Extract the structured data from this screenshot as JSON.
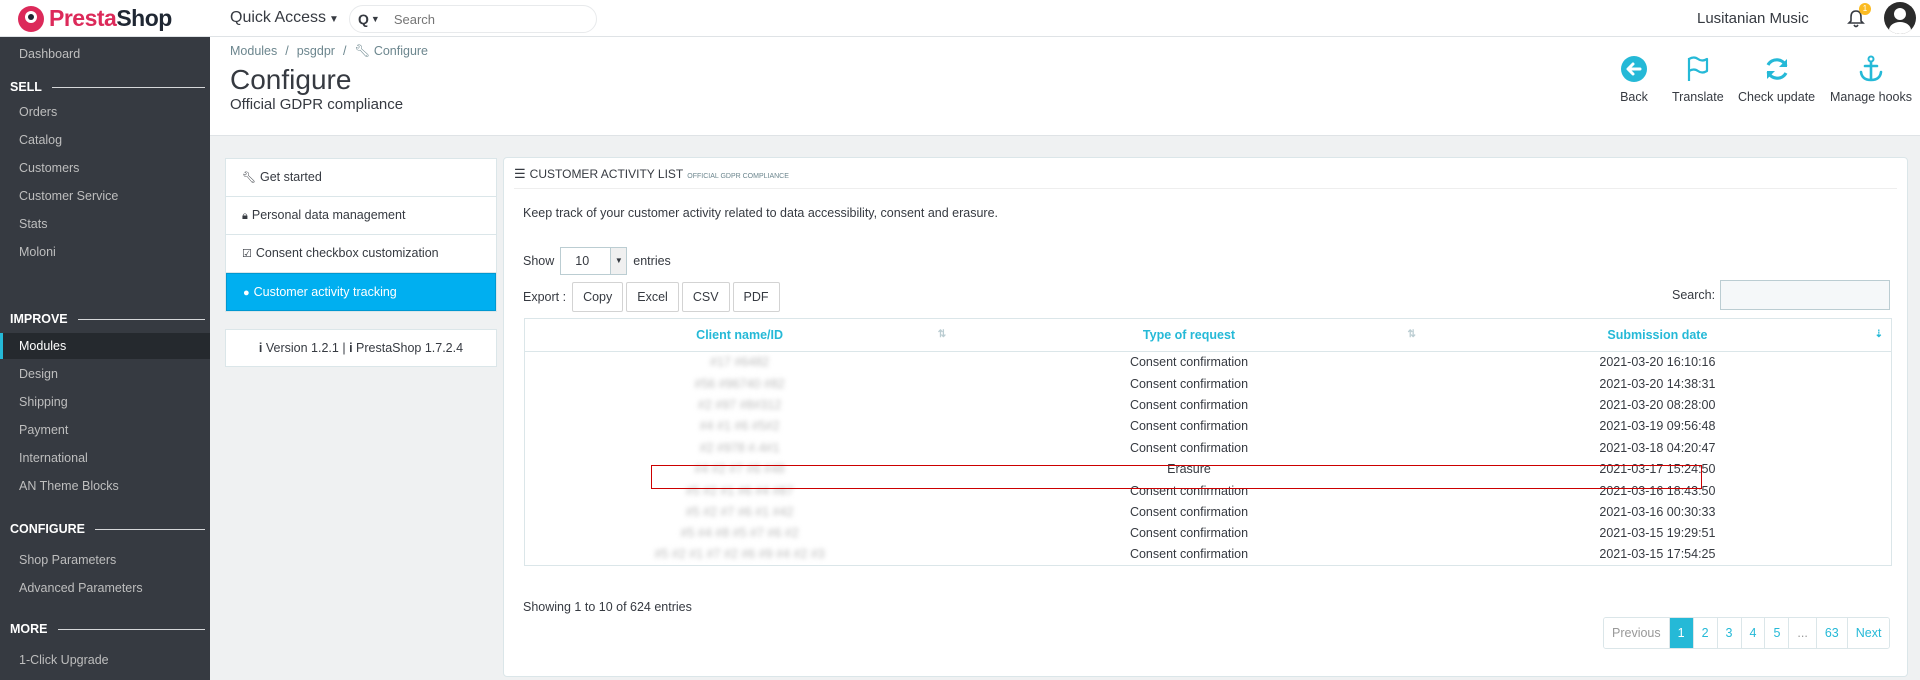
{
  "header": {
    "logo_prefix": "Presta",
    "logo_suffix": "Shop",
    "quick_access": "Quick Access",
    "search_placeholder": "Search",
    "shop_name": "Lusitanian Music",
    "notification_count": "1"
  },
  "sidebar": {
    "dashboard": "Dashboard",
    "sections": [
      {
        "title": "SELL",
        "items": [
          "Orders",
          "Catalog",
          "Customers",
          "Customer Service",
          "Stats",
          "Moloni"
        ]
      },
      {
        "title": "IMPROVE",
        "items": [
          "Modules",
          "Design",
          "Shipping",
          "Payment",
          "International",
          "AN Theme Blocks"
        ]
      },
      {
        "title": "CONFIGURE",
        "items": [
          "Shop Parameters",
          "Advanced Parameters"
        ]
      },
      {
        "title": "MORE",
        "items": [
          "1-Click Upgrade"
        ]
      }
    ],
    "active_item": "Modules"
  },
  "breadcrumb": [
    "Modules",
    "psgdpr",
    "Configure"
  ],
  "page": {
    "title": "Configure",
    "subtitle": "Official GDPR compliance"
  },
  "toolbar": {
    "back": "Back",
    "translate": "Translate",
    "check_update": "Check update",
    "manage_hooks": "Manage hooks"
  },
  "module_menu": {
    "items": [
      "Get started",
      "Personal data management",
      "Consent checkbox customization",
      "Customer activity tracking"
    ],
    "active": "Customer activity tracking",
    "version": "Version 1.2.1 | ",
    "prestashop_version": "PrestaShop 1.7.2.4"
  },
  "panel": {
    "title": "CUSTOMER ACTIVITY LIST",
    "title_small": "OFFICIAL GDPR COMPLIANCE",
    "description": "Keep track of your customer activity related to data accessibility, consent and erasure.",
    "show_label": "Show",
    "show_value": "10",
    "entries_label": "entries",
    "export_label": "Export :",
    "export_buttons": [
      "Copy",
      "Excel",
      "CSV",
      "PDF"
    ],
    "search_label": "Search:",
    "showing_text": "Showing 1 to 10 of 624 entries"
  },
  "table": {
    "columns": [
      "Client name/ID",
      "Type of request",
      "Submission date"
    ],
    "rows": [
      {
        "client": "#17 #6482",
        "type": "Consent confirmation",
        "date": "2021-03-20 16:10:16"
      },
      {
        "client": "#56 #96740 #82",
        "type": "Consent confirmation",
        "date": "2021-03-20 14:38:31"
      },
      {
        "client": "#2 #97 #8#312",
        "type": "Consent confirmation",
        "date": "2021-03-20 08:28:00"
      },
      {
        "client": "#4 #1 #6 #5#2",
        "type": "Consent confirmation",
        "date": "2021-03-19 09:56:48"
      },
      {
        "client": "#2 #978 #.4#1",
        "type": "Consent confirmation",
        "date": "2021-03-18 04:20:47"
      },
      {
        "client": "#4 #2 #7 #6 #48",
        "type": "Erasure",
        "date": "2021-03-17 15:24:50"
      },
      {
        "client": "#5 #2 #1 #6 #4 #87",
        "type": "Consent confirmation",
        "date": "2021-03-16 18:43:50"
      },
      {
        "client": "#5 #2 #7 #6 #1 #42",
        "type": "Consent confirmation",
        "date": "2021-03-16 00:30:33"
      },
      {
        "client": "#5 #4 #8 #5 #7 #6 #2",
        "type": "Consent confirmation",
        "date": "2021-03-15 19:29:51"
      },
      {
        "client": "#5 #2 #1 #7 #2 #6 #9 #4 #2 #3",
        "type": "Consent confirmation",
        "date": "2021-03-15 17:54:25"
      }
    ]
  },
  "pagination": [
    "Previous",
    "1",
    "2",
    "3",
    "4",
    "5",
    "...",
    "63",
    "Next"
  ],
  "colors": {
    "accent": "#25b9d7",
    "active_menu": "#00aff0",
    "sidebar_bg": "#363a41",
    "highlight_border": "#cc0000"
  }
}
